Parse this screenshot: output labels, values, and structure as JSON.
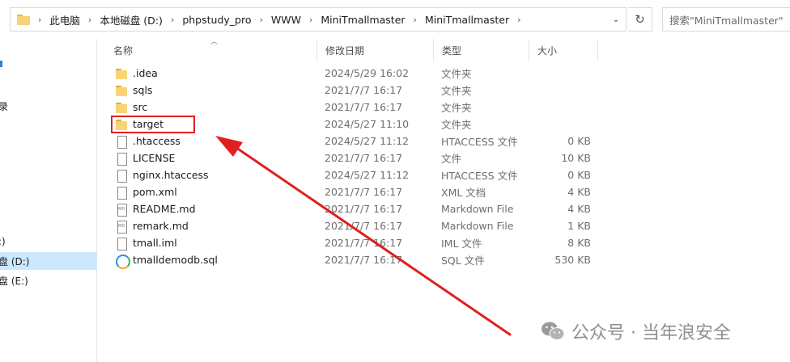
{
  "address": {
    "crumbs": [
      "此电脑",
      "本地磁盘 (D:)",
      "phpstudy_pro",
      "WWW",
      "MiniTmallmaster",
      "MiniTmallmaster"
    ],
    "search_placeholder": "搜索\"MiniTmallmaster\""
  },
  "nav": {
    "items": [
      {
        "label": "",
        "glyph": "blue-mark"
      },
      {
        "label": "录"
      },
      {
        "label": ":)"
      },
      {
        "label": "盘 (D:)",
        "selected": true
      },
      {
        "label": "盘 (E:)"
      }
    ]
  },
  "columns": {
    "name": "名称",
    "date": "修改日期",
    "type": "类型",
    "size": "大小"
  },
  "files": [
    {
      "name": ".idea",
      "date": "2024/5/29 16:02",
      "type": "文件夹",
      "size": "",
      "icon": "folder-icon"
    },
    {
      "name": "sqls",
      "date": "2021/7/7 16:17",
      "type": "文件夹",
      "size": "",
      "icon": "folder-icon"
    },
    {
      "name": "src",
      "date": "2021/7/7 16:17",
      "type": "文件夹",
      "size": "",
      "icon": "folder-icon"
    },
    {
      "name": "target",
      "date": "2024/5/27 11:10",
      "type": "文件夹",
      "size": "",
      "icon": "folder-icon"
    },
    {
      "name": ".htaccess",
      "date": "2024/5/27 11:12",
      "type": "HTACCESS 文件",
      "size": "0 KB",
      "icon": "file-icon"
    },
    {
      "name": "LICENSE",
      "date": "2021/7/7 16:17",
      "type": "文件",
      "size": "10 KB",
      "icon": "file-icon"
    },
    {
      "name": "nginx.htaccess",
      "date": "2024/5/27 11:12",
      "type": "HTACCESS 文件",
      "size": "0 KB",
      "icon": "file-icon"
    },
    {
      "name": "pom.xml",
      "date": "2021/7/7 16:17",
      "type": "XML 文档",
      "size": "4 KB",
      "icon": "file-icon"
    },
    {
      "name": "README.md",
      "date": "2021/7/7 16:17",
      "type": "Markdown File",
      "size": "4 KB",
      "icon": "markdown-file-icon"
    },
    {
      "name": "remark.md",
      "date": "2021/7/7 16:17",
      "type": "Markdown File",
      "size": "1 KB",
      "icon": "markdown-file-icon"
    },
    {
      "name": "tmall.iml",
      "date": "2021/7/7 16:17",
      "type": "IML 文件",
      "size": "8 KB",
      "icon": "file-icon"
    },
    {
      "name": "tmalldemodb.sql",
      "date": "2021/7/7 16:17",
      "type": "SQL 文件",
      "size": "530 KB",
      "icon": "sql-file-icon"
    }
  ],
  "annotation": {
    "highlighted_item": "target",
    "color": "#e02020"
  },
  "watermark": {
    "text": "公众号 · 当年浪安全"
  }
}
